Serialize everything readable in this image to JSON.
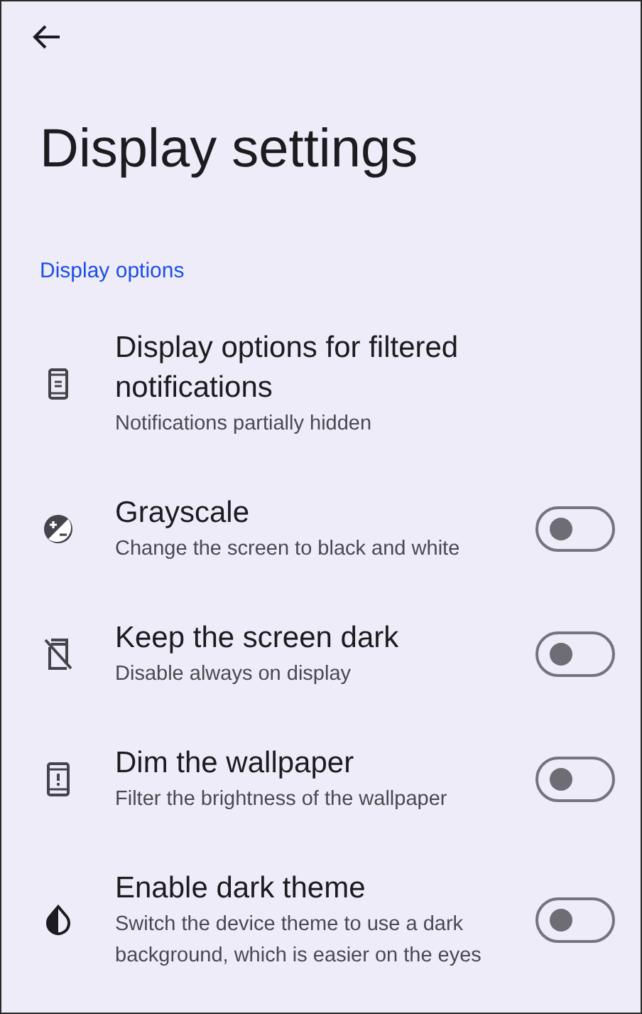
{
  "header": {
    "title": "Display settings"
  },
  "section": {
    "title": "Display options"
  },
  "items": [
    {
      "kind": "nav",
      "title": "Display options for filtered notifications",
      "subtitle": "Notifications partially hidden"
    },
    {
      "kind": "toggle",
      "title": "Grayscale",
      "subtitle": "Change the screen to black and white",
      "on": false
    },
    {
      "kind": "toggle",
      "title": "Keep the screen dark",
      "subtitle": "Disable always on display",
      "on": false
    },
    {
      "kind": "toggle",
      "title": "Dim the wallpaper",
      "subtitle": "Filter the brightness of the wallpaper",
      "on": false
    },
    {
      "kind": "toggle",
      "title": "Enable dark theme",
      "subtitle": "Switch the device theme to use a dark background, which is easier on the eyes",
      "on": false
    }
  ]
}
